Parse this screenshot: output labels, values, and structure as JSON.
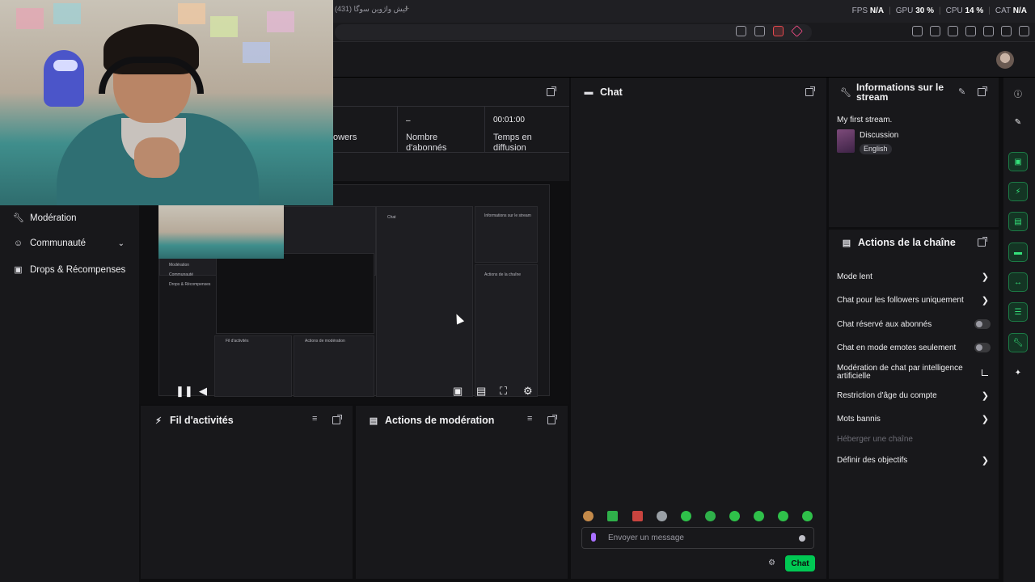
{
  "browser": {
    "tab_title": "لیش واژوین سوگا (431)",
    "tab_plus": "+",
    "stats": [
      {
        "label": "FPS",
        "value": "N/A"
      },
      {
        "label": "GPU",
        "value": "30 %"
      },
      {
        "label": "CPU",
        "value": "14 %"
      },
      {
        "label": "CAT",
        "value": "N/A"
      }
    ]
  },
  "sidebar": {
    "items": [
      {
        "label": "Modération",
        "icon": "wrench-icon"
      },
      {
        "label": "Communauté",
        "icon": "people-icon",
        "chevron": "⌄"
      },
      {
        "label": "Drops & Récompenses",
        "icon": "gift-icon"
      }
    ]
  },
  "stream_stats": {
    "followers_label": "owers",
    "subs_value": "–",
    "subs_label": "Nombre d'abonnés",
    "time_value": "00:01:00",
    "time_label": "Temps en diffusion"
  },
  "panels": {
    "activity_title": "Fil d'activités",
    "mod_actions_title": "Actions de modération",
    "chat_title": "Chat",
    "stream_info_title": "Informations sur le stream",
    "channel_actions_title": "Actions de la chaîne"
  },
  "stream_info": {
    "title": "My first stream.",
    "category": "Discussion",
    "language": "English"
  },
  "channel_actions": [
    {
      "label": "Mode lent",
      "control": "chevron"
    },
    {
      "label": "Chat pour les followers uniquement",
      "control": "chevron"
    },
    {
      "label": "Chat réservé aux abonnés",
      "control": "toggle"
    },
    {
      "label": "Chat en mode emotes seulement",
      "control": "toggle"
    },
    {
      "label": "Modération de chat par intelligence artificielle",
      "control": "external"
    },
    {
      "label": "Restriction d'âge du compte",
      "control": "chevron"
    },
    {
      "label": "Mots bannis",
      "control": "chevron"
    },
    {
      "label": "Héberger une chaîne",
      "control": "none",
      "disabled": true
    },
    {
      "label": "Définir des objectifs",
      "control": "chevron"
    }
  ],
  "chat": {
    "placeholder": "Envoyer un message",
    "send_label": "Chat"
  },
  "colors": {
    "accent": "#00c853",
    "purple": "#a970ff",
    "panel_bg": "#18181b",
    "page_bg": "#0e0e10"
  },
  "inner_preview": {
    "chat": "Chat",
    "info": "Informations sur le stream",
    "activity": "Fil d'activités",
    "mod": "Actions de modération",
    "chan": "Actions de la chaîne",
    "mod_side": "Modération",
    "comm_side": "Communauté",
    "drops_side": "Drops & Récompenses"
  }
}
